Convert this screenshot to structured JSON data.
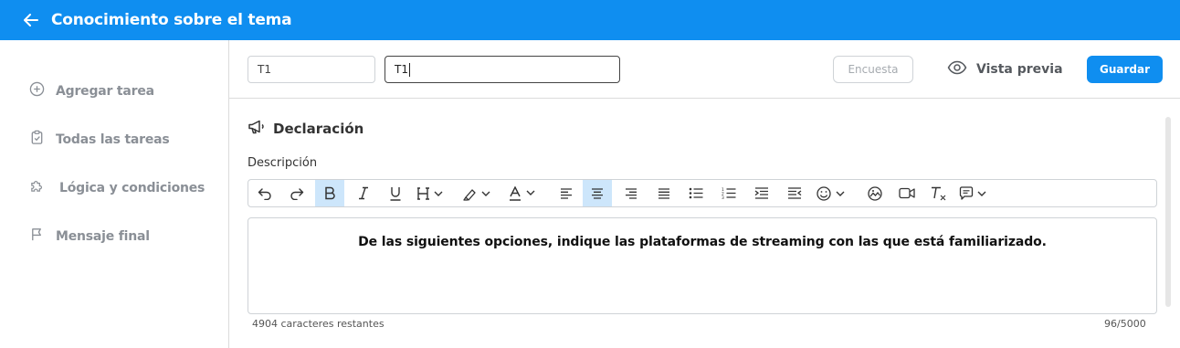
{
  "header": {
    "title": "Conocimiento sobre el tema",
    "back_icon": "arrow-left-icon"
  },
  "sidebar": {
    "items": [
      {
        "label": "Agregar tarea",
        "icon": "plus-circle-icon"
      },
      {
        "label": "Todas las tareas",
        "icon": "clipboard-check-icon"
      },
      {
        "label": "Lógica y condiciones",
        "icon": "puzzle-icon"
      },
      {
        "label": "Mensaje final",
        "icon": "flag-icon"
      }
    ]
  },
  "task_header": {
    "short_name_value": "T1",
    "name_value": "T1",
    "encuesta_label": "Encuesta",
    "preview_label": "Vista previa",
    "save_label": "Guardar"
  },
  "section": {
    "icon": "megaphone-icon",
    "title": "Declaración"
  },
  "editor": {
    "label": "Descripción",
    "content": "De las siguientes opciones, indique las plataformas de streaming con las que está familiarizado.",
    "remaining": "4904 caracteres restantes",
    "counter": "96/5000",
    "toolbar": [
      "undo-icon",
      "redo-icon",
      "bold-icon",
      "italic-icon",
      "underline-icon",
      "heading-icon",
      "highlight-icon",
      "font-color-icon",
      "align-left-icon",
      "align-center-icon",
      "align-right-icon",
      "align-justify-icon",
      "bullet-list-icon",
      "numbered-list-icon",
      "indent-icon",
      "outdent-icon",
      "emoji-icon",
      "image-icon",
      "video-icon",
      "clear-format-icon",
      "comment-icon"
    ]
  },
  "colors": {
    "primary": "#0f8ef0",
    "active_tool": "#cde6fb",
    "muted_text": "#8a8f96"
  }
}
